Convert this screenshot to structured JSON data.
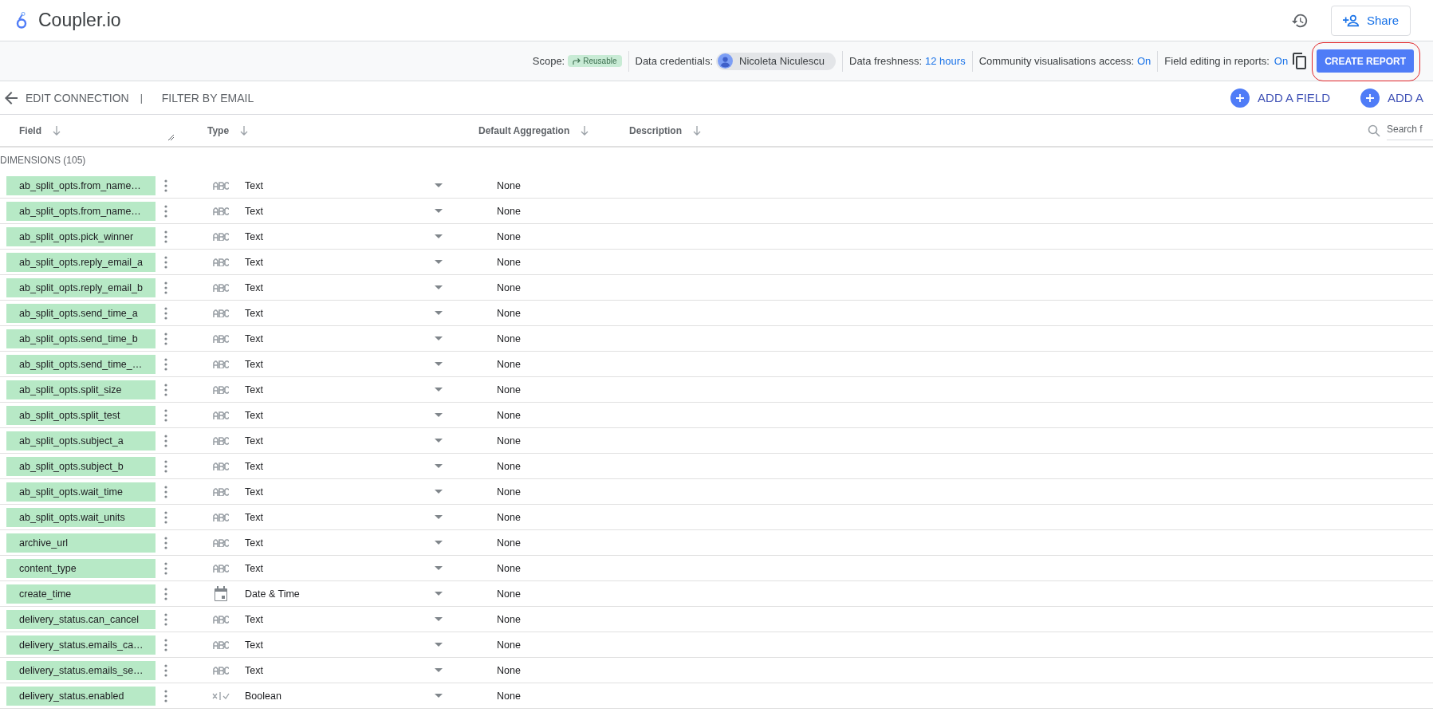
{
  "app": {
    "title": "Coupler.io",
    "share_label": "Share"
  },
  "toolbar": {
    "scope_label": "Scope:",
    "scope_badge": "Reusable",
    "credentials_label": "Data credentials:",
    "credentials_user": "Nicoleta Niculescu",
    "freshness_label": "Data freshness:",
    "freshness_value": "12 hours",
    "community_label": "Community visualisations access:",
    "community_value": "On",
    "editing_label": "Field editing in reports:",
    "editing_value": "On",
    "create_button": "CREATE REPORT",
    "create_button_highlighted": true
  },
  "nav": {
    "back_label": "EDIT CONNECTION",
    "separator": "|",
    "filter_label": "FILTER BY EMAIL",
    "add_buttons": [
      "ADD A FIELD",
      "ADD A"
    ]
  },
  "table": {
    "columns": [
      "Field",
      "Type",
      "Default Aggregation",
      "Description"
    ],
    "search_placeholder": "Search f",
    "section_label": "DIMENSIONS (105)",
    "rows": [
      {
        "field": "ab_split_opts.from_name…",
        "kind": "text",
        "type": "Text",
        "aggregation": "None"
      },
      {
        "field": "ab_split_opts.from_name…",
        "kind": "text",
        "type": "Text",
        "aggregation": "None"
      },
      {
        "field": "ab_split_opts.pick_winner",
        "kind": "text",
        "type": "Text",
        "aggregation": "None"
      },
      {
        "field": "ab_split_opts.reply_email_a",
        "kind": "text",
        "type": "Text",
        "aggregation": "None"
      },
      {
        "field": "ab_split_opts.reply_email_b",
        "kind": "text",
        "type": "Text",
        "aggregation": "None"
      },
      {
        "field": "ab_split_opts.send_time_a",
        "kind": "text",
        "type": "Text",
        "aggregation": "None"
      },
      {
        "field": "ab_split_opts.send_time_b",
        "kind": "text",
        "type": "Text",
        "aggregation": "None"
      },
      {
        "field": "ab_split_opts.send_time_…",
        "kind": "text",
        "type": "Text",
        "aggregation": "None"
      },
      {
        "field": "ab_split_opts.split_size",
        "kind": "text",
        "type": "Text",
        "aggregation": "None"
      },
      {
        "field": "ab_split_opts.split_test",
        "kind": "text",
        "type": "Text",
        "aggregation": "None"
      },
      {
        "field": "ab_split_opts.subject_a",
        "kind": "text",
        "type": "Text",
        "aggregation": "None"
      },
      {
        "field": "ab_split_opts.subject_b",
        "kind": "text",
        "type": "Text",
        "aggregation": "None"
      },
      {
        "field": "ab_split_opts.wait_time",
        "kind": "text",
        "type": "Text",
        "aggregation": "None"
      },
      {
        "field": "ab_split_opts.wait_units",
        "kind": "text",
        "type": "Text",
        "aggregation": "None"
      },
      {
        "field": "archive_url",
        "kind": "text",
        "type": "Text",
        "aggregation": "None"
      },
      {
        "field": "content_type",
        "kind": "text",
        "type": "Text",
        "aggregation": "None"
      },
      {
        "field": "create_time",
        "kind": "datetime",
        "type": "Date & Time",
        "aggregation": "None"
      },
      {
        "field": "delivery_status.can_cancel",
        "kind": "text",
        "type": "Text",
        "aggregation": "None"
      },
      {
        "field": "delivery_status.emails_ca…",
        "kind": "text",
        "type": "Text",
        "aggregation": "None"
      },
      {
        "field": "delivery_status.emails_se…",
        "kind": "text",
        "type": "Text",
        "aggregation": "None"
      },
      {
        "field": "delivery_status.enabled",
        "kind": "boolean",
        "type": "Boolean",
        "aggregation": "None"
      }
    ]
  }
}
